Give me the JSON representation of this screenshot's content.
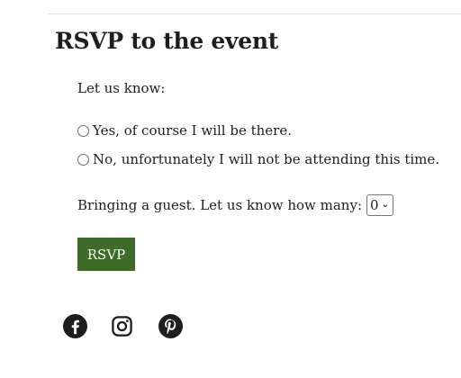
{
  "section": {
    "title": "RSVP to the event"
  },
  "form": {
    "prompt": "Let us know:",
    "options": [
      {
        "label": "Yes, of course I will be there.",
        "selected": false
      },
      {
        "label": "No, unfortunately I will not be attending this time.",
        "selected": false
      }
    ],
    "guest_label": "Bringing a guest. Let us know how many:",
    "guest_count": "0",
    "submit_label": "RSVP"
  },
  "social": [
    {
      "icon": "facebook-icon"
    },
    {
      "icon": "instagram-icon"
    },
    {
      "icon": "pinterest-icon"
    }
  ],
  "colors": {
    "button_bg": "#3e6b29",
    "button_text": "#ffffff",
    "text": "#1e1e1e",
    "divider": "#e3e3e3"
  }
}
